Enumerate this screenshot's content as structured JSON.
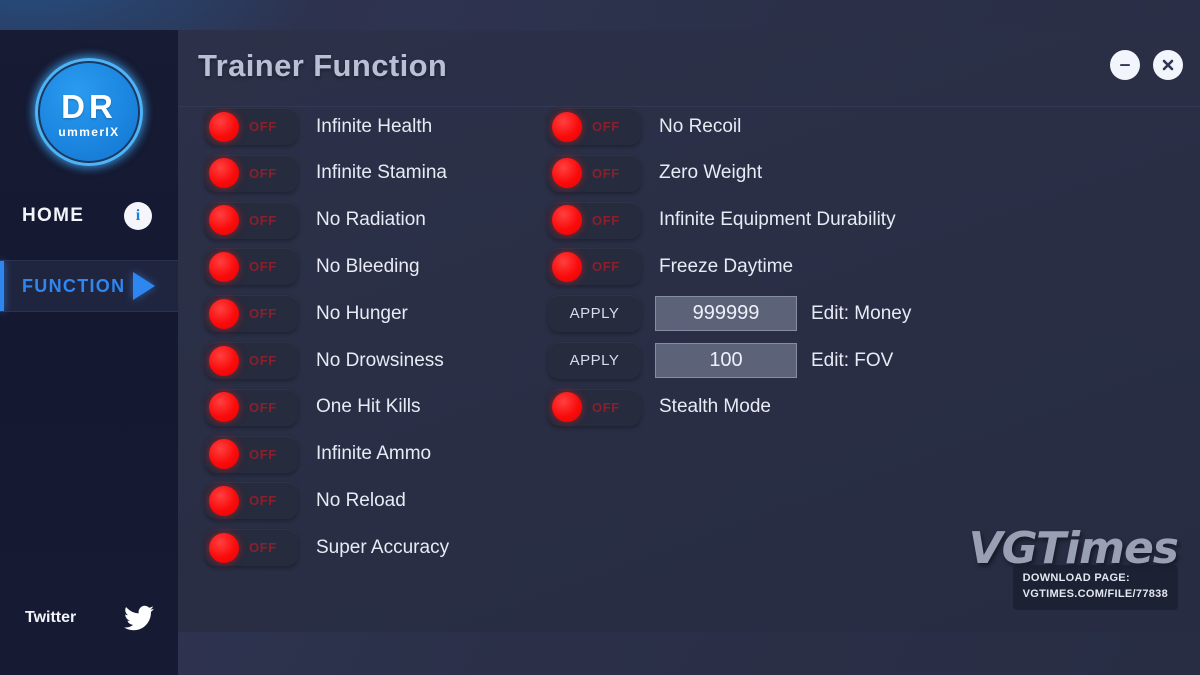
{
  "window": {
    "title": "Trainer Function",
    "minimize_label": "minimize",
    "close_label": "close"
  },
  "sidebar": {
    "logo": {
      "main": "DR",
      "sub": "ummerIX"
    },
    "items": [
      {
        "label": "HOME",
        "icon": "info-icon",
        "active": false
      },
      {
        "label": "FUNCTION",
        "icon": "play-triangle-icon",
        "active": true
      }
    ],
    "social": {
      "label": "Twitter",
      "icon": "twitter-bird-icon"
    }
  },
  "toggle_state_off": "OFF",
  "apply_label": "APPLY",
  "left_column": [
    {
      "label": "Infinite Health",
      "state": "OFF"
    },
    {
      "label": "Infinite Stamina",
      "state": "OFF"
    },
    {
      "label": "No Radiation",
      "state": "OFF"
    },
    {
      "label": "No Bleeding",
      "state": "OFF"
    },
    {
      "label": "No Hunger",
      "state": "OFF"
    },
    {
      "label": "No Drowsiness",
      "state": "OFF"
    },
    {
      "label": "One Hit Kills",
      "state": "OFF"
    },
    {
      "label": "Infinite Ammo",
      "state": "OFF"
    },
    {
      "label": "No Reload",
      "state": "OFF"
    },
    {
      "label": "Super Accuracy",
      "state": "OFF"
    }
  ],
  "right_column": [
    {
      "type": "toggle",
      "label": "No Recoil",
      "state": "OFF"
    },
    {
      "type": "toggle",
      "label": "Zero Weight",
      "state": "OFF"
    },
    {
      "type": "toggle",
      "label": "Infinite Equipment Durability",
      "state": "OFF"
    },
    {
      "type": "toggle",
      "label": "Freeze Daytime",
      "state": "OFF"
    },
    {
      "type": "edit",
      "button": "APPLY",
      "value": "999999",
      "label": "Edit: Money"
    },
    {
      "type": "edit",
      "button": "APPLY",
      "value": "100",
      "label": "Edit: FOV"
    },
    {
      "type": "toggle",
      "label": "Stealth Mode",
      "state": "OFF"
    }
  ],
  "watermark": {
    "brand": "VGTimes",
    "download_line1": "DOWNLOAD PAGE:",
    "download_line2": "VGTIMES.COM/FILE/77838"
  },
  "colors": {
    "accent_blue": "#2e86f0",
    "toggle_red": "#fa0b0b",
    "panel_bg": "#2a2f46",
    "sidebar_bg": "#141830"
  }
}
